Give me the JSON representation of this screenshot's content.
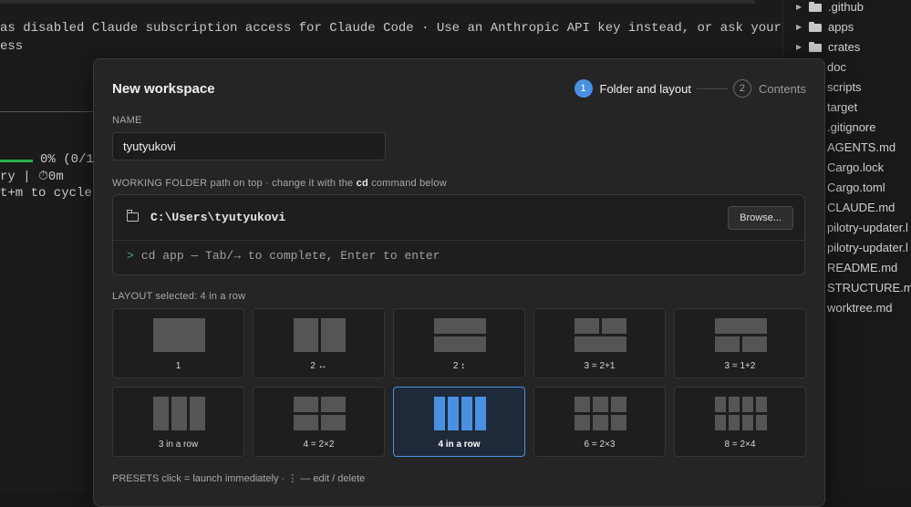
{
  "terminal": {
    "line1": "as disabled Claude subscription access for Claude Code · Use an Anthropic API key instead, or ask your",
    "line2": "ess",
    "progress": "0% (0/1",
    "status": "ry | ⏱0m",
    "hint": "t+m to cycle)"
  },
  "explorer": {
    "items": [
      {
        "name": ".github",
        "type": "dir"
      },
      {
        "name": "apps",
        "type": "dir"
      },
      {
        "name": "crates",
        "type": "dir"
      },
      {
        "name": "doc",
        "type": "file"
      },
      {
        "name": "scripts",
        "type": "file"
      },
      {
        "name": "target",
        "type": "file"
      },
      {
        "name": ".gitignore",
        "type": "file"
      },
      {
        "name": "AGENTS.md",
        "type": "file"
      },
      {
        "name": "Cargo.lock",
        "type": "file"
      },
      {
        "name": "Cargo.toml",
        "type": "file"
      },
      {
        "name": "CLAUDE.md",
        "type": "file"
      },
      {
        "name": "pilotry-updater.l",
        "type": "file"
      },
      {
        "name": "pilotry-updater.l",
        "type": "file"
      },
      {
        "name": "README.md",
        "type": "file"
      },
      {
        "name": "STRUCTURE.md",
        "type": "file"
      },
      {
        "name": "worktree.md",
        "type": "file"
      }
    ]
  },
  "modal": {
    "title": "New workspace",
    "steps": [
      {
        "num": "1",
        "label": "Folder and layout",
        "active": true
      },
      {
        "num": "2",
        "label": "Contents",
        "active": false
      }
    ],
    "name_label": "NAME",
    "name_value": "tyutyukovi",
    "folder_label": "WORKING FOLDER",
    "folder_hint_pre": "path on top · change it with the",
    "folder_hint_cmd": "cd",
    "folder_hint_post": "command below",
    "folder_path": "C:\\Users\\tyutyukovi",
    "browse_label": "Browse...",
    "cd_prompt": ">",
    "cd_placeholder": "cd app — Tab/→ to complete, Enter to enter",
    "layout_label": "LAYOUT",
    "layout_selected": "selected: 4 in a row",
    "layouts": [
      {
        "label": "1"
      },
      {
        "label": "2 ↔"
      },
      {
        "label": "2 ↕"
      },
      {
        "label": "3 = 2+1"
      },
      {
        "label": "3 = 1+2"
      },
      {
        "label": "3 in a row"
      },
      {
        "label": "4 = 2×2"
      },
      {
        "label": "4 in a row",
        "selected": true
      },
      {
        "label": "6 = 2×3"
      },
      {
        "label": "8 = 2×4"
      }
    ],
    "presets_label": "PRESETS",
    "presets_hint": "click = launch immediately · ⋮ — edit / delete"
  },
  "colors": {
    "accent": "#4a90e2",
    "prompt": "#4cae6a",
    "progress": "#29b34a"
  }
}
